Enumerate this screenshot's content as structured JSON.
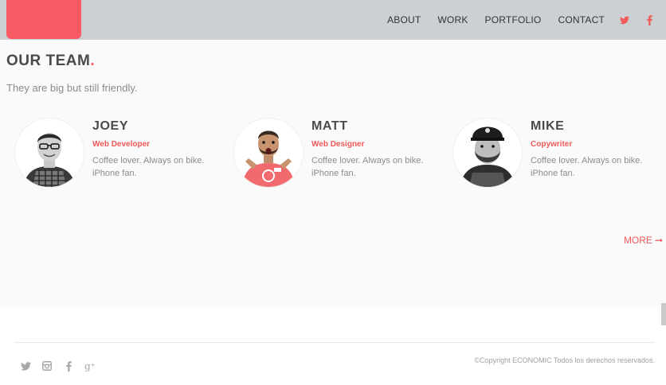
{
  "nav": {
    "links": [
      "ABOUT",
      "WORK",
      "PORTFOLIO",
      "CONTACT"
    ],
    "social": [
      "twitter-icon",
      "facebook-icon"
    ]
  },
  "team": {
    "title": "OUR TEAM",
    "title_dot": ".",
    "subtitle": "They are big but still friendly.",
    "members": [
      {
        "name": "JOEY",
        "role": "Web Developer",
        "bio": "Coffee lover. Always on bike. iPhone fan."
      },
      {
        "name": "MATT",
        "role": "Web Designer",
        "bio": "Coffee lover. Always on bike. iPhone fan."
      },
      {
        "name": "MIKE",
        "role": "Copywriter",
        "bio": "Coffee lover. Always on bike. iPhone fan."
      }
    ],
    "more_label": "MORE",
    "more_arrow": "➞"
  },
  "footer": {
    "social": [
      "twitter-icon",
      "instagram-icon",
      "facebook-icon",
      "google-plus-icon"
    ],
    "copyright": "©Copyright ECONOMIC Todos los derechos reservados."
  },
  "colors": {
    "accent": "#fa5a64",
    "header_bg": "#ccd0d3"
  }
}
